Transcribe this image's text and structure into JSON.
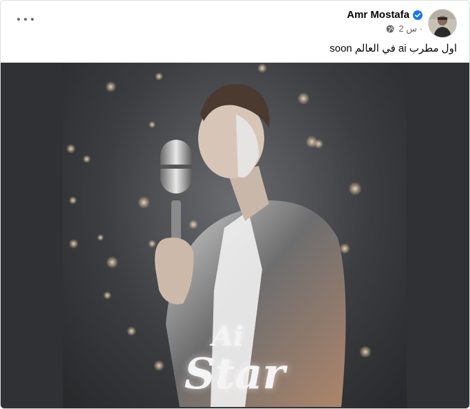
{
  "post": {
    "author_name": "Amr Mostafa",
    "timestamp": "2 س ·",
    "privacy_icon": "globe-icon",
    "verified_icon": "verified-badge-icon",
    "more_icon": "more-options-icon",
    "caption": "اول مطرب ai في العالم soon"
  },
  "image": {
    "ai_text": "Ai",
    "star_text": "Star"
  },
  "colors": {
    "verified": "#1877f2",
    "meta_text": "#65676b",
    "media_bg": "#2f3134"
  }
}
